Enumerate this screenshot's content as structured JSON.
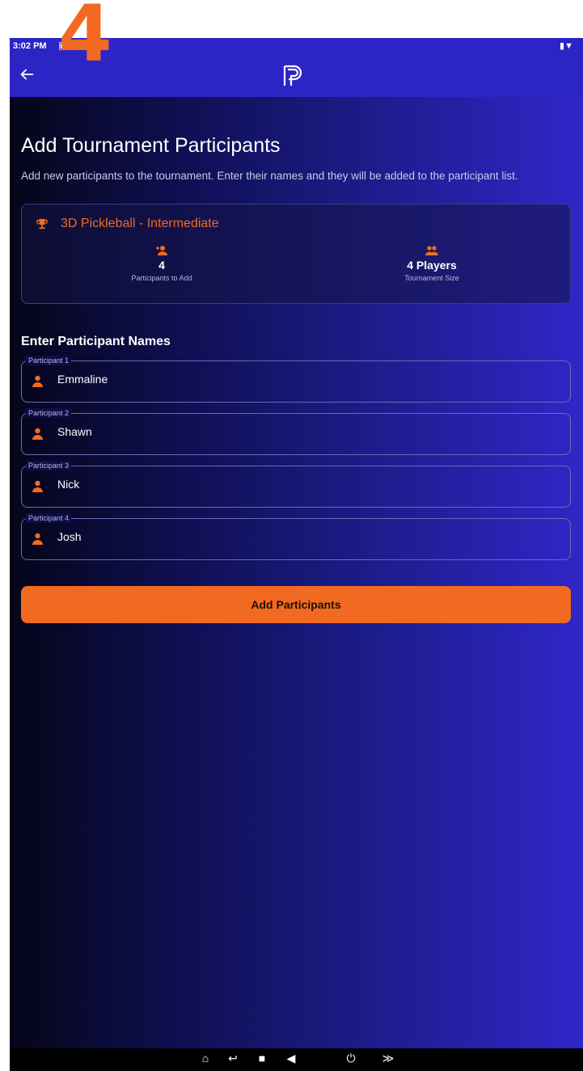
{
  "overlay": {
    "step_number": "4"
  },
  "statusbar": {
    "time": "3:02 PM"
  },
  "appbar": {
    "logo": "P",
    "back_icon": "arrow-left-icon"
  },
  "page": {
    "title": "Add Tournament Participants",
    "description": "Add new participants to the tournament. Enter their names and they will be added to the participant list."
  },
  "tournament_card": {
    "name": "3D Pickleball - Intermediate",
    "stats": [
      {
        "icon": "person-add-icon",
        "value": "4",
        "label": "Participants to Add"
      },
      {
        "icon": "group-icon",
        "value": "4 Players",
        "label": "Tournament Size"
      }
    ]
  },
  "participants_section": {
    "title": "Enter Participant Names",
    "fields": [
      {
        "label": "Participant 1",
        "value": "Emmaline"
      },
      {
        "label": "Participant 2",
        "value": "Shawn"
      },
      {
        "label": "Participant 3",
        "value": "Nick"
      },
      {
        "label": "Participant 4",
        "value": "Josh"
      }
    ]
  },
  "actions": {
    "add_button": "Add Participants"
  },
  "colors": {
    "accent": "#f26a21",
    "appbar": "#2c25c5"
  }
}
